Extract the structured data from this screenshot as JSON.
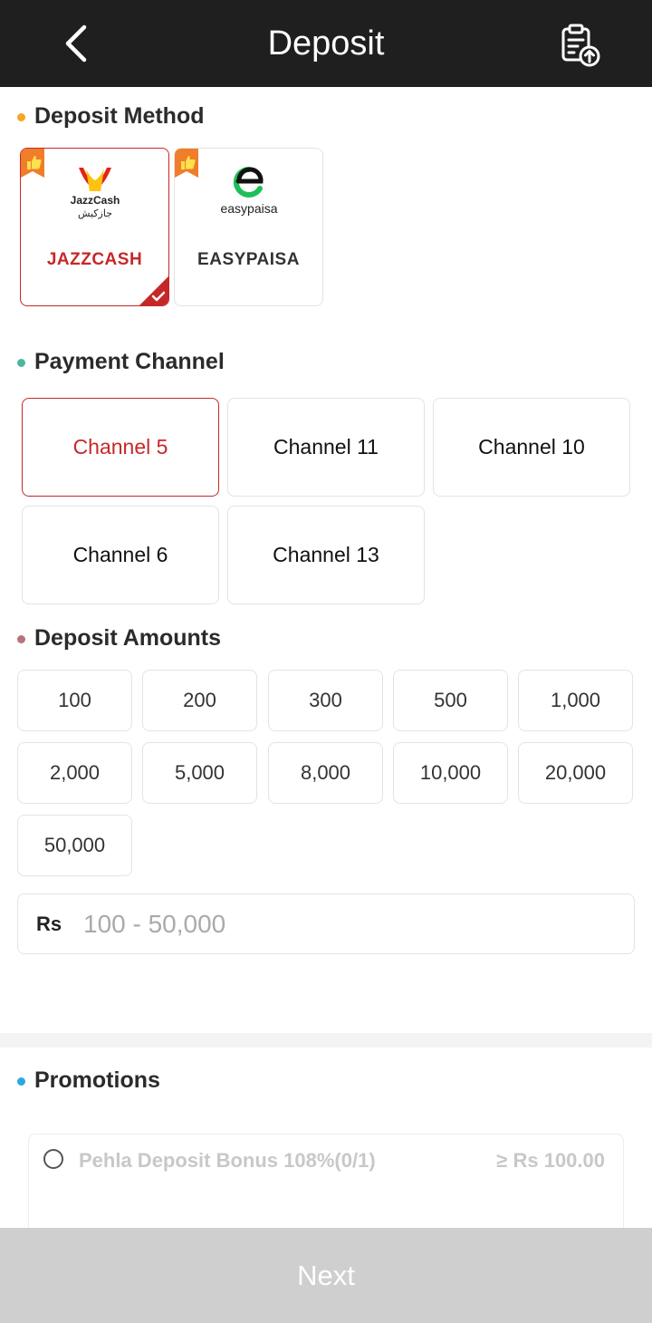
{
  "header": {
    "title": "Deposit",
    "back_icon": "chevron-left-icon",
    "record_icon": "clipboard-upload-icon"
  },
  "deposit_method": {
    "title": "Deposit Method",
    "dot_color": "#f5a623",
    "methods": [
      {
        "name": "JAZZCASH",
        "logo_text": "JazzCash",
        "logo_subtext": "جازکیش",
        "selected": true,
        "icon": "jazzcash-logo-icon"
      },
      {
        "name": "EASYPAISA",
        "logo_text": "easypaisa",
        "selected": false,
        "icon": "easypaisa-logo-icon"
      }
    ]
  },
  "payment_channel": {
    "title": "Payment Channel",
    "dot_color": "#4db6a0",
    "channels": [
      {
        "label": "Channel 5",
        "selected": true
      },
      {
        "label": "Channel 11",
        "selected": false
      },
      {
        "label": "Channel 10",
        "selected": false
      },
      {
        "label": "Channel 6",
        "selected": false
      },
      {
        "label": "Channel 13",
        "selected": false
      }
    ]
  },
  "deposit_amounts": {
    "title": "Deposit Amounts",
    "dot_color": "#b5727a",
    "amounts": [
      "100",
      "200",
      "300",
      "500",
      "1,000",
      "2,000",
      "5,000",
      "8,000",
      "10,000",
      "20,000",
      "50,000"
    ],
    "currency": "Rs",
    "placeholder": "100 - 50,000"
  },
  "promotions": {
    "title": "Promotions",
    "dot_color": "#29a9e0",
    "items": [
      {
        "name": "Pehla Deposit Bonus 108%(0/1)",
        "min": "≥ Rs 100.00",
        "selected": false
      }
    ]
  },
  "footer": {
    "next_label": "Next"
  },
  "colors": {
    "accent": "#c62828",
    "header_bg": "#1f1f1f",
    "disabled_button": "#cfcfcf"
  }
}
